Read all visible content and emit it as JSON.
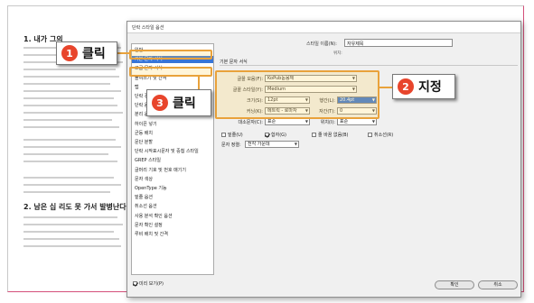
{
  "document": {
    "heading1": "1. 내가 그의",
    "heading2": "2. 남은 십 리도 못 가서 발병난다."
  },
  "dialog": {
    "title": "단락 스타일 옵션",
    "style_name_label": "스타일 이름(N):",
    "style_name_value": "자유제목",
    "location_label": "위치:",
    "section_title": "기본 문자 서식",
    "sidebar": {
      "items": [
        "일반",
        "기본 문자 서식",
        "고급 문자 서식",
        "들여쓰기 및 간격",
        "탭",
        "단락 경력",
        "단락 음영",
        "분리 옵션",
        "하이픈 넣기",
        "균등 배치",
        "문단 분할",
        "단락 시작표시문자 및 중첩 스타일",
        "GREP 스타일",
        "글머리 기호 및 번호 매기기",
        "문자 색상",
        "OpenType 기능",
        "밑줄 옵션",
        "취소선 옵션",
        "사용 분석 확인 옵션",
        "문자 확인 설정",
        "루비 배치 및 간격"
      ],
      "selected_index": 1
    },
    "fields": {
      "font_family_label": "글꼴 모음(F):",
      "font_family_value": "KoPub돋움체",
      "font_style_label": "글꼴 스타일(Y):",
      "font_style_value": "Medium",
      "size_label": "크기(S):",
      "size_value": "12pt",
      "leading_label": "행간(L):",
      "leading_value": "20.4pt",
      "kerning_label": "커닝(K):",
      "kerning_value": "메트릭 - 로마자",
      "tracking_label": "자간(T):",
      "tracking_value": "0",
      "case_label": "대소문자(C):",
      "case_value": "표준",
      "position_label": "위치(I):",
      "position_value": "표준",
      "underline_label": "밑줄(U)",
      "ligature_label": "합자(G)",
      "nobreak_label": "줄 바꿈 없음(B)",
      "strike_label": "취소선(R)",
      "char_align_label": "문자 정렬:",
      "char_align_value": "전각 가운데"
    },
    "preview_label": "미리 보기(P)",
    "ok_label": "확인",
    "cancel_label": "취소"
  },
  "callouts": [
    {
      "number": "1",
      "text": "클릭"
    },
    {
      "number": "2",
      "text": "지정"
    },
    {
      "number": "3",
      "text": "클릭"
    }
  ],
  "colors": {
    "badge": "#e8452c",
    "highlight": "#e9a23b",
    "selection": "#3875d7"
  }
}
